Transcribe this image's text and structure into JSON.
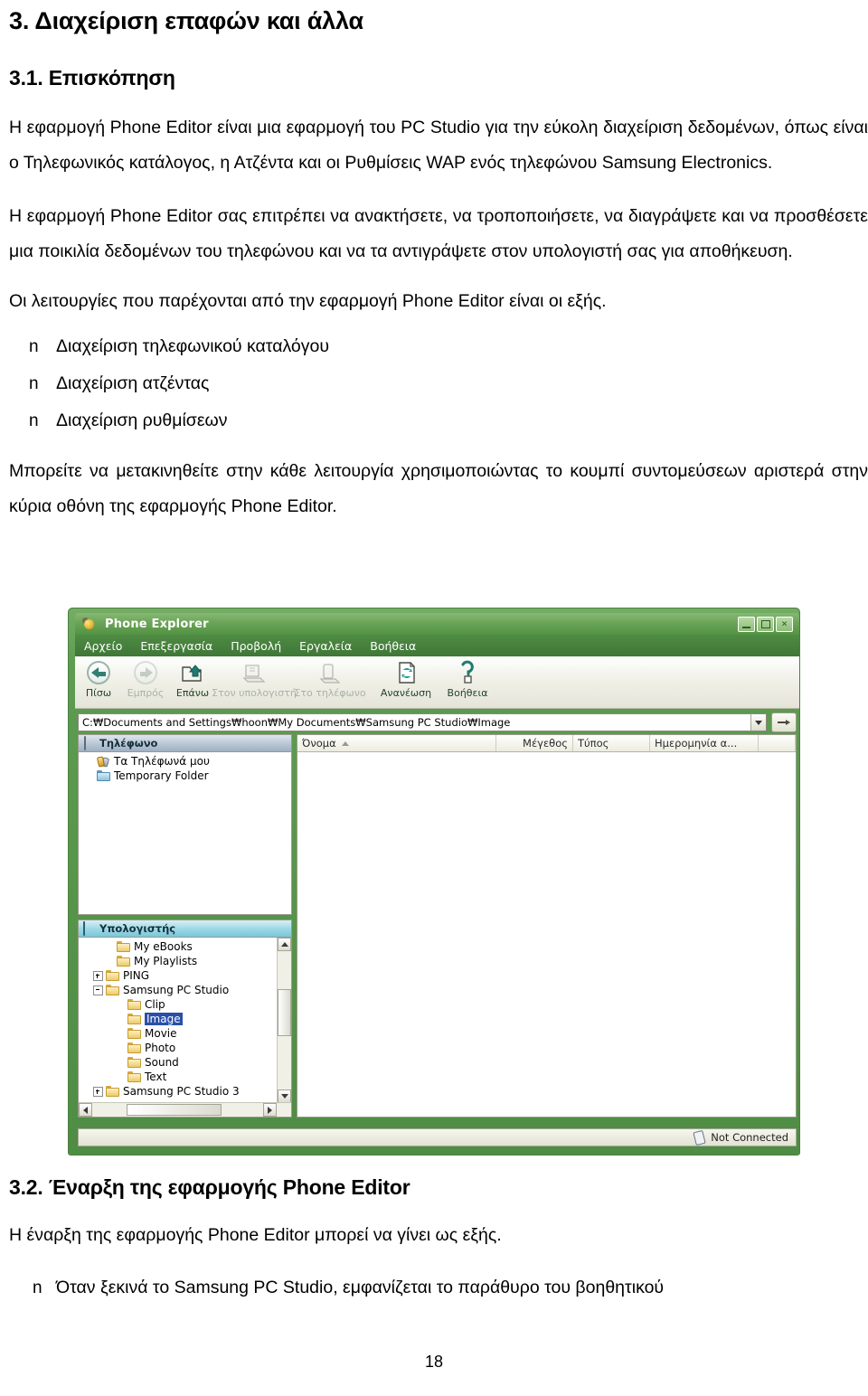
{
  "document": {
    "chapter_heading": "3. Διαχείριση επαφών και άλλα",
    "section1_heading": "3.1. Επισκόπηση",
    "para1": "Η εφαρμογή Phone Editor είναι μια εφαρμογή του PC Studio για την εύκολη διαχείριση δεδομένων, όπως είναι ο Τηλεφωνικός κατάλογος, η Ατζέντα και οι Ρυθμίσεις WAP ενός τηλεφώνου Samsung Electronics.",
    "para2": "Η εφαρμογή Phone Editor σας επιτρέπει να ανακτήσετε, να τροποποιήσετε, να διαγράψετε και να προσθέσετε μια ποικιλία δεδομένων του τηλεφώνου και να τα αντιγράψετε στον υπολογιστή σας για αποθήκευση.",
    "para3": "Οι λειτουργίες που παρέχονται από την εφαρμογή Phone Editor είναι οι εξής.",
    "bullet_glyph": "n",
    "features": [
      "Διαχείριση τηλεφωνικού καταλόγου",
      "Διαχείριση ατζέντας",
      "Διαχείριση ρυθμίσεων"
    ],
    "para4": "Μπορείτε να μετακινηθείτε στην κάθε λειτουργία χρησιμοποιώντας το κουμπί συντομεύσεων αριστερά στην κύρια οθόνη της εφαρμογής Phone Editor.",
    "section2_heading": "3.2. Έναρξη της εφαρμογής Phone Editor",
    "para5": "Η έναρξη της εφαρμογής Phone Editor μπορεί να γίνει ως εξής.",
    "steps": [
      "Όταν ξεκινά το Samsung PC Studio, εμφανίζεται το παράθυρο του βοηθητικού"
    ],
    "page_number": "18"
  },
  "screenshot": {
    "window_title": "Phone Explorer",
    "window_buttons": {
      "minimize": "minimize-icon",
      "maximize": "maximize-icon",
      "close": "×"
    },
    "menu": [
      "Αρχείο",
      "Επεξεργασία",
      "Προβολή",
      "Εργαλεία",
      "Βοήθεια"
    ],
    "toolbar": [
      {
        "label": "Πίσω",
        "icon": "back-arrow-icon",
        "enabled": true
      },
      {
        "label": "Εμπρός",
        "icon": "forward-arrow-icon",
        "enabled": false
      },
      {
        "label": "Επάνω",
        "icon": "up-folder-icon",
        "enabled": true
      },
      {
        "label": "Στον υπολογιστή",
        "icon": "to-computer-icon",
        "enabled": false
      },
      {
        "label": "Στο τηλέφωνο",
        "icon": "to-phone-icon",
        "enabled": false
      },
      {
        "label": "Ανανέωση",
        "icon": "refresh-icon",
        "enabled": true
      },
      {
        "label": "Βοήθεια",
        "icon": "help-icon",
        "enabled": true
      }
    ],
    "address": {
      "value": "C:₩Documents and Settings₩hoon₩My Documents₩Samsung PC Studio₩Image",
      "dropdown_icon": "chevron-down-icon",
      "go_icon": "go-arrow-icon"
    },
    "phone_panel": {
      "header": "Τηλέφωνο",
      "header_icon": "phone-icon",
      "items": [
        {
          "label": "Τα Τηλέφωνά μου",
          "icon": "my-phones-icon"
        },
        {
          "label": "Temporary Folder",
          "icon": "temp-folder-icon"
        }
      ]
    },
    "computer_panel": {
      "header": "Υπολογιστής",
      "header_icon": "computer-icon",
      "items": [
        {
          "label": "My eBooks",
          "indent": 28,
          "expander": "none",
          "selected": false
        },
        {
          "label": "My Playlists",
          "indent": 28,
          "expander": "none",
          "selected": false
        },
        {
          "label": "PING",
          "indent": 16,
          "expander": "plus",
          "selected": false
        },
        {
          "label": "Samsung PC Studio",
          "indent": 16,
          "expander": "minus",
          "selected": false
        },
        {
          "label": "Clip",
          "indent": 40,
          "expander": "none",
          "selected": false
        },
        {
          "label": "Image",
          "indent": 40,
          "expander": "none",
          "selected": true
        },
        {
          "label": "Movie",
          "indent": 40,
          "expander": "none",
          "selected": false
        },
        {
          "label": "Photo",
          "indent": 40,
          "expander": "none",
          "selected": false
        },
        {
          "label": "Sound",
          "indent": 40,
          "expander": "none",
          "selected": false
        },
        {
          "label": "Text",
          "indent": 40,
          "expander": "none",
          "selected": false
        },
        {
          "label": "Samsung PC Studio 3",
          "indent": 16,
          "expander": "plus",
          "selected": false
        }
      ]
    },
    "file_list": {
      "columns": [
        "Όνομα",
        "Μέγεθος",
        "Τύπος",
        "Ημερομηνία α..."
      ],
      "sort_icon": "sort-ascending-icon",
      "rows": []
    },
    "status": {
      "text": "Not Connected",
      "icon": "phone-disconnected-icon"
    },
    "colors": {
      "window_chrome": "#5d9b53",
      "menu_bar": "#3f7737",
      "selection": "#2a4fa8",
      "phone_header": "#b9c6d4",
      "computer_header": "#9fd9e6"
    }
  }
}
